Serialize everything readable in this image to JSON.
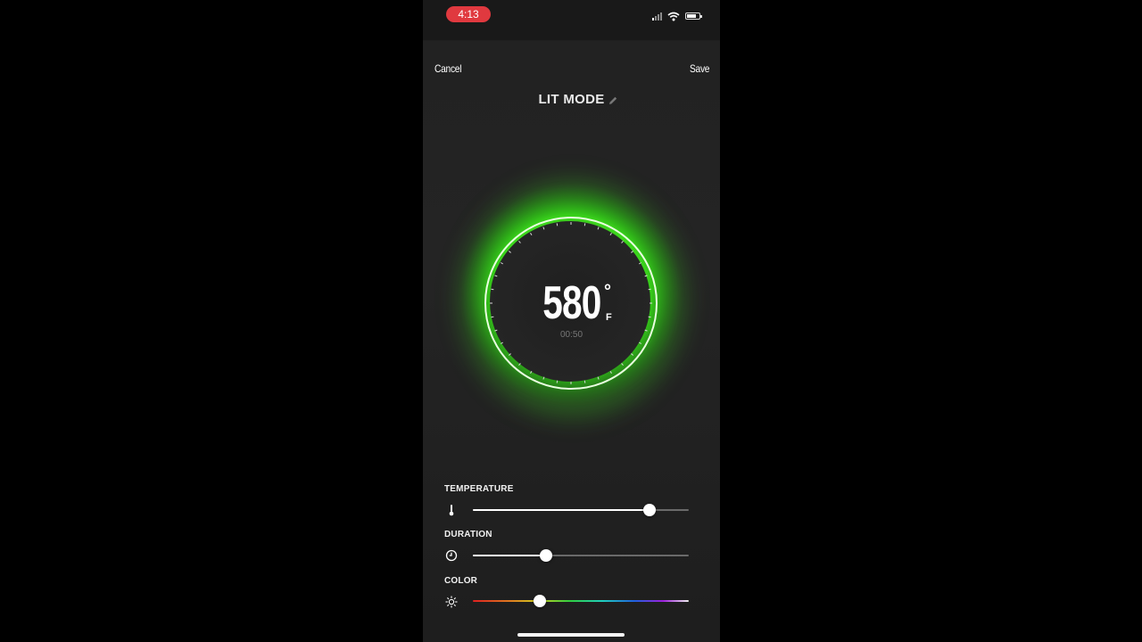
{
  "status_bar": {
    "time": "4:13"
  },
  "nav": {
    "cancel_label": "Cancel",
    "save_label": "Save"
  },
  "mode": {
    "title": "LIT MODE"
  },
  "dial": {
    "temperature": "580",
    "degree_symbol": "°",
    "unit": "F",
    "timer": "00:50",
    "glow_color": "#4cff2a"
  },
  "controls": {
    "temperature": {
      "label": "TEMPERATURE",
      "icon": "thermometer-icon",
      "value_fraction": 0.82
    },
    "duration": {
      "label": "DURATION",
      "icon": "clock-icon",
      "value_fraction": 0.34
    },
    "color": {
      "label": "COLOR",
      "icon": "sun-icon",
      "value_fraction": 0.31
    }
  }
}
